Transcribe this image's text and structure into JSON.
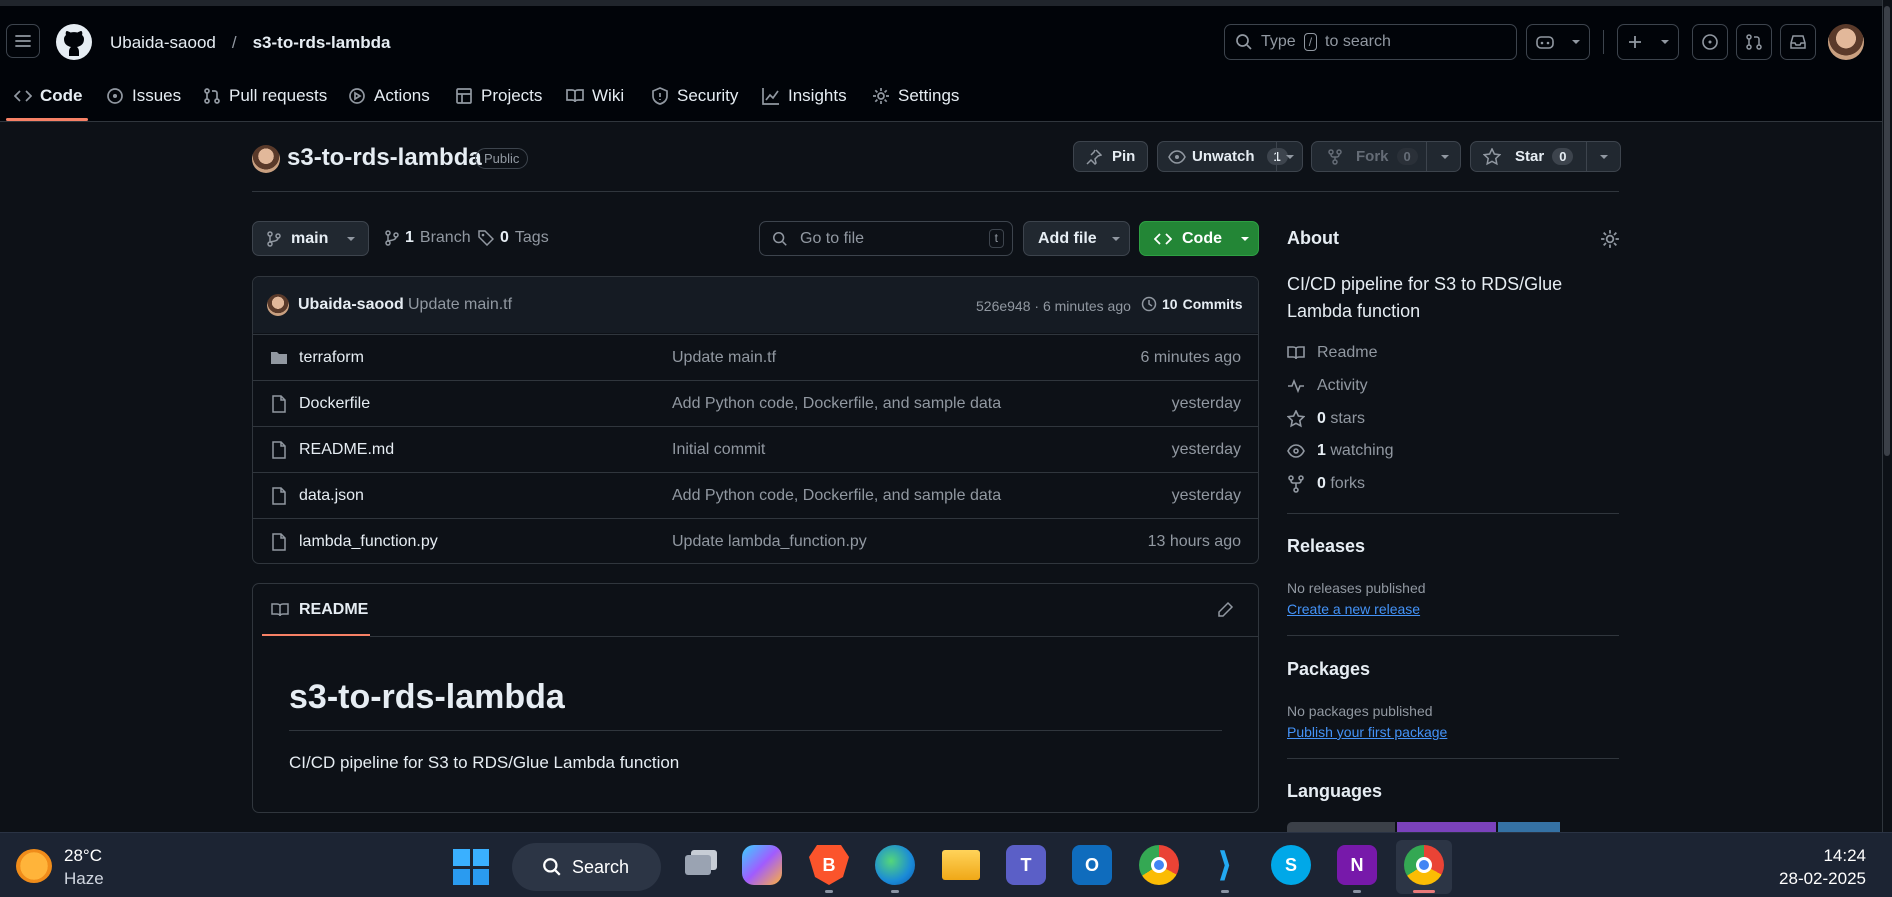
{
  "header": {
    "owner": "Ubaida-saood",
    "separator": "/",
    "repo": "s3-to-rds-lambda",
    "search_prefix": "Type",
    "search_key": "/",
    "search_suffix": "to search"
  },
  "tabs": [
    {
      "label": "Code",
      "icon": "code-icon"
    },
    {
      "label": "Issues",
      "icon": "issue-icon"
    },
    {
      "label": "Pull requests",
      "icon": "pull-request-icon"
    },
    {
      "label": "Actions",
      "icon": "play-icon"
    },
    {
      "label": "Projects",
      "icon": "table-icon"
    },
    {
      "label": "Wiki",
      "icon": "book-icon"
    },
    {
      "label": "Security",
      "icon": "shield-icon"
    },
    {
      "label": "Insights",
      "icon": "graph-icon"
    },
    {
      "label": "Settings",
      "icon": "gear-icon"
    }
  ],
  "repo_header": {
    "name": "s3-to-rds-lambda",
    "visibility": "Public",
    "pin_label": "Pin",
    "unwatch_label": "Unwatch",
    "watch_count": "1",
    "fork_label": "Fork",
    "fork_count": "0",
    "star_label": "Star",
    "star_count": "0"
  },
  "toolbar": {
    "branch": "main",
    "branch_count": "1",
    "branch_label": "Branch",
    "tag_count": "0",
    "tag_label": "Tags",
    "goto_placeholder": "Go to file",
    "goto_key": "t",
    "add_file_label": "Add file",
    "code_label": "Code"
  },
  "commit": {
    "author": "Ubaida-saood",
    "message": "Update main.tf",
    "meta": "526e948 · 6 minutes ago",
    "commits_count": "10",
    "commits_label": "Commits"
  },
  "files": [
    {
      "name": "terraform",
      "type": "folder",
      "message": "Update main.tf",
      "time": "6 minutes ago"
    },
    {
      "name": "Dockerfile",
      "type": "file",
      "message": "Add Python code, Dockerfile, and sample data",
      "time": "yesterday"
    },
    {
      "name": "README.md",
      "type": "file",
      "message": "Initial commit",
      "time": "yesterday"
    },
    {
      "name": "data.json",
      "type": "file",
      "message": "Add Python code, Dockerfile, and sample data",
      "time": "yesterday"
    },
    {
      "name": "lambda_function.py",
      "type": "file",
      "message": "Update lambda_function.py",
      "time": "13 hours ago"
    }
  ],
  "readme": {
    "tab_label": "README",
    "title": "s3-to-rds-lambda",
    "body": "CI/CD pipeline for S3 to RDS/Glue Lambda function"
  },
  "about": {
    "heading": "About",
    "description": "CI/CD pipeline for S3 to RDS/Glue Lambda function",
    "readme": "Readme",
    "activity": "Activity",
    "stars_count": "0",
    "stars_label": "stars",
    "watching_count": "1",
    "watching_label": "watching",
    "forks_count": "0",
    "forks_label": "forks"
  },
  "releases": {
    "heading": "Releases",
    "empty": "No releases published",
    "link": "Create a new release"
  },
  "packages": {
    "heading": "Packages",
    "empty": "No packages published",
    "link": "Publish your first package"
  },
  "languages": {
    "heading": "Languages",
    "bar": [
      {
        "color": "#3b4048",
        "fraction": 0.33
      },
      {
        "color": "#7b42bc",
        "fraction": 0.3
      },
      {
        "color": "#3572A5",
        "fraction": 0.19
      }
    ]
  },
  "taskbar": {
    "temperature": "28°C",
    "condition": "Haze",
    "search_label": "Search",
    "time": "14:24",
    "date": "28-02-2025"
  },
  "colors": {
    "accent_green": "#238636",
    "link_blue": "#4493f8",
    "tab_underline": "#f78166"
  }
}
